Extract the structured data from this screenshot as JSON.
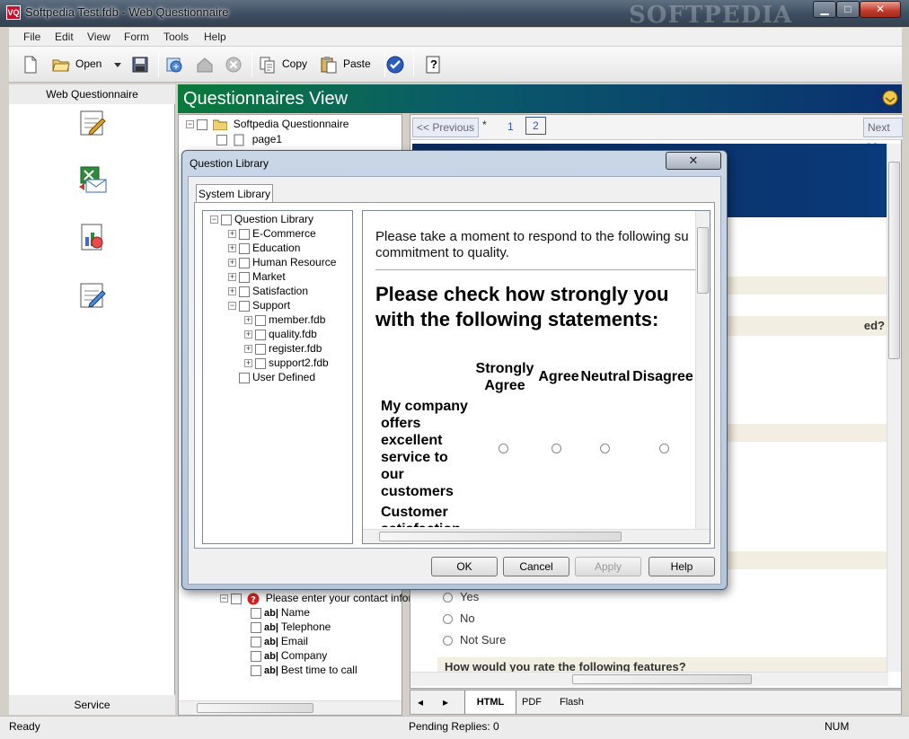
{
  "window": {
    "title": "Softpedia Test.fdb - Web Questionnaire",
    "watermark": "SOFTPEDIA",
    "app_icon": "VQ",
    "controls": {
      "minimize": "▁",
      "maximize": "□",
      "close": "✕"
    }
  },
  "menu": [
    "File",
    "Edit",
    "View",
    "Form",
    "Tools",
    "Help"
  ],
  "toolbar": {
    "open_label": "Open",
    "copy_label": "Copy",
    "paste_label": "Paste",
    "help_label": "?"
  },
  "left_panel": {
    "header": "Web Questionnaire",
    "footer": "Service"
  },
  "main": {
    "header": "Questionnaires View"
  },
  "tree": {
    "root": "Softpedia Questionnaire",
    "page": "page1",
    "question": "Please enter your contact inform",
    "fields": [
      "Name",
      "Telephone",
      "Email",
      "Company",
      "Best time to call"
    ]
  },
  "preview": {
    "prev_label": "<< Previous",
    "next_label": "Next >>",
    "pages": [
      "*",
      "1",
      "2"
    ],
    "q_fragment": "ed?",
    "options": [
      "Yes",
      "No",
      "Not Sure"
    ],
    "rate_question": "How would you rate the following features?"
  },
  "bottom_tabs": [
    "HTML",
    "PDF",
    "Flash"
  ],
  "status": {
    "left": "Ready",
    "middle": "Pending Replies: 0",
    "right": "NUM"
  },
  "dialog": {
    "title": "Question Library",
    "close": "✕",
    "tab": "System Library",
    "library": {
      "root": "Question Library",
      "categories": [
        "E-Commerce",
        "Education",
        "Human Resource",
        "Market",
        "Satisfaction",
        "Support"
      ],
      "support_files": [
        "member.fdb",
        "quality.fdb",
        "register.fdb",
        "support2.fdb"
      ],
      "user_defined": "User Defined"
    },
    "preview": {
      "intro_line1": "Please take a moment to respond to the following su",
      "intro_line2": "commitment to quality.",
      "heading_line1": "Please check how strongly you",
      "heading_line2": "with the following statements:",
      "columns": [
        "Strongly Agree",
        "Agree",
        "Neutral",
        "Disagree"
      ],
      "row1": "My company offers excellent service to our customers",
      "row2": "Customer satisfaction"
    },
    "buttons": {
      "ok": "OK",
      "cancel": "Cancel",
      "apply": "Apply",
      "help": "Help"
    }
  }
}
